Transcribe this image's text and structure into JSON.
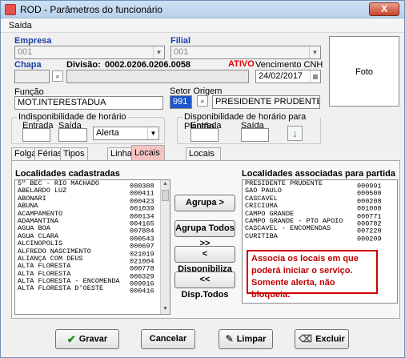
{
  "window": {
    "title": "ROD - Parâmetros do funcionário",
    "close_label": "X"
  },
  "menu": {
    "items": [
      "Saída"
    ]
  },
  "empresa": {
    "label": "Empresa",
    "value": "001"
  },
  "filial": {
    "label": "Filial",
    "value": "001"
  },
  "chapa": {
    "label": "Chapa",
    "value": ""
  },
  "divisao": {
    "label": "Divisão:",
    "value": "0002.0206.0206.0058"
  },
  "status": {
    "text": "ATIVO"
  },
  "vencimento": {
    "label": "Vencimento CNH",
    "value": "24/02/2017"
  },
  "foto": {
    "label": "Foto"
  },
  "funcao": {
    "label": "Função",
    "value": "MOT.INTERESTADUA"
  },
  "setor": {
    "label": "Setor Origem",
    "code": "991",
    "name": "PRESIDENTE PRUDENTE"
  },
  "indisp": {
    "caption": "Indisponibilidade de horário",
    "entrada": "Entrada",
    "saida": "Saída",
    "tipo": "Alerta"
  },
  "plantao": {
    "caption": "Disponibilidade de horário para Plantão",
    "entrada": "Entrada",
    "saida": "Saída"
  },
  "tabs": [
    "Folgas",
    "Férias",
    "Tipos de Frota",
    "Linhas",
    "Locais de partida",
    "Locais de Origem"
  ],
  "left_list": {
    "title": "Localidades cadastradas",
    "rows": [
      {
        "name": "5º BEC - RIO MACHADO",
        "code": "000308"
      },
      {
        "name": "ABELARDO LUZ",
        "code": "000411"
      },
      {
        "name": "ABONARI",
        "code": "000423"
      },
      {
        "name": "ABUNÃ",
        "code": "001039"
      },
      {
        "name": "ACAMPAMENTO",
        "code": "000134"
      },
      {
        "name": "ADAMANTINA",
        "code": "004165"
      },
      {
        "name": "ÁGUA BOA",
        "code": "007884"
      },
      {
        "name": "ÁGUA CLARA",
        "code": "000543"
      },
      {
        "name": "ALCINÓPOLIS",
        "code": "000697"
      },
      {
        "name": "ALFREDO NASCIMENTO",
        "code": "021019"
      },
      {
        "name": "ALIANÇA COM DEUS",
        "code": "021004"
      },
      {
        "name": "ALTA FLORESTA",
        "code": "000778"
      },
      {
        "name": "ALTA FLORESTA",
        "code": "006329"
      },
      {
        "name": "ALTA FLORESTA - ENCOMENDA",
        "code": "009916"
      },
      {
        "name": "ALTA FLORESTA D'OESTE",
        "code": "000416"
      }
    ]
  },
  "right_list": {
    "title": "Localidades associadas para partida",
    "rows": [
      {
        "name": "PRESIDENTE PRUDENTE",
        "code": "000991"
      },
      {
        "name": "SÃO PAULO",
        "code": "000500"
      },
      {
        "name": "CASCAVEL",
        "code": "000208"
      },
      {
        "name": "CRICIUMA",
        "code": "001000"
      },
      {
        "name": "CAMPO GRANDE",
        "code": "000771"
      },
      {
        "name": "CAMPO GRANDE - PTO APOIO",
        "code": "000782"
      },
      {
        "name": "CASCAVEL - ENCOMENDAS",
        "code": "007220"
      },
      {
        "name": "CURITIBA",
        "code": "000209"
      }
    ]
  },
  "actions": {
    "agrupa": "Agrupa >",
    "agrupa_todos": "Agrupa Todos >>",
    "disponibiliza": "< Disponibiliza",
    "disp_todos": "<< Disp.Todos"
  },
  "note": "Associa os locais em que poderá iniciar o serviço. Somente alerta, não bloqueia.",
  "footer": {
    "gravar": "Gravar",
    "cancelar": "Cancelar",
    "limpar": "Limpar",
    "excluir": "Excluir"
  },
  "colors": {
    "accent_blue": "#1a3fa8",
    "status_red": "#e00000",
    "tab_active": "#f6c3c3",
    "note_border": "#d00000"
  }
}
